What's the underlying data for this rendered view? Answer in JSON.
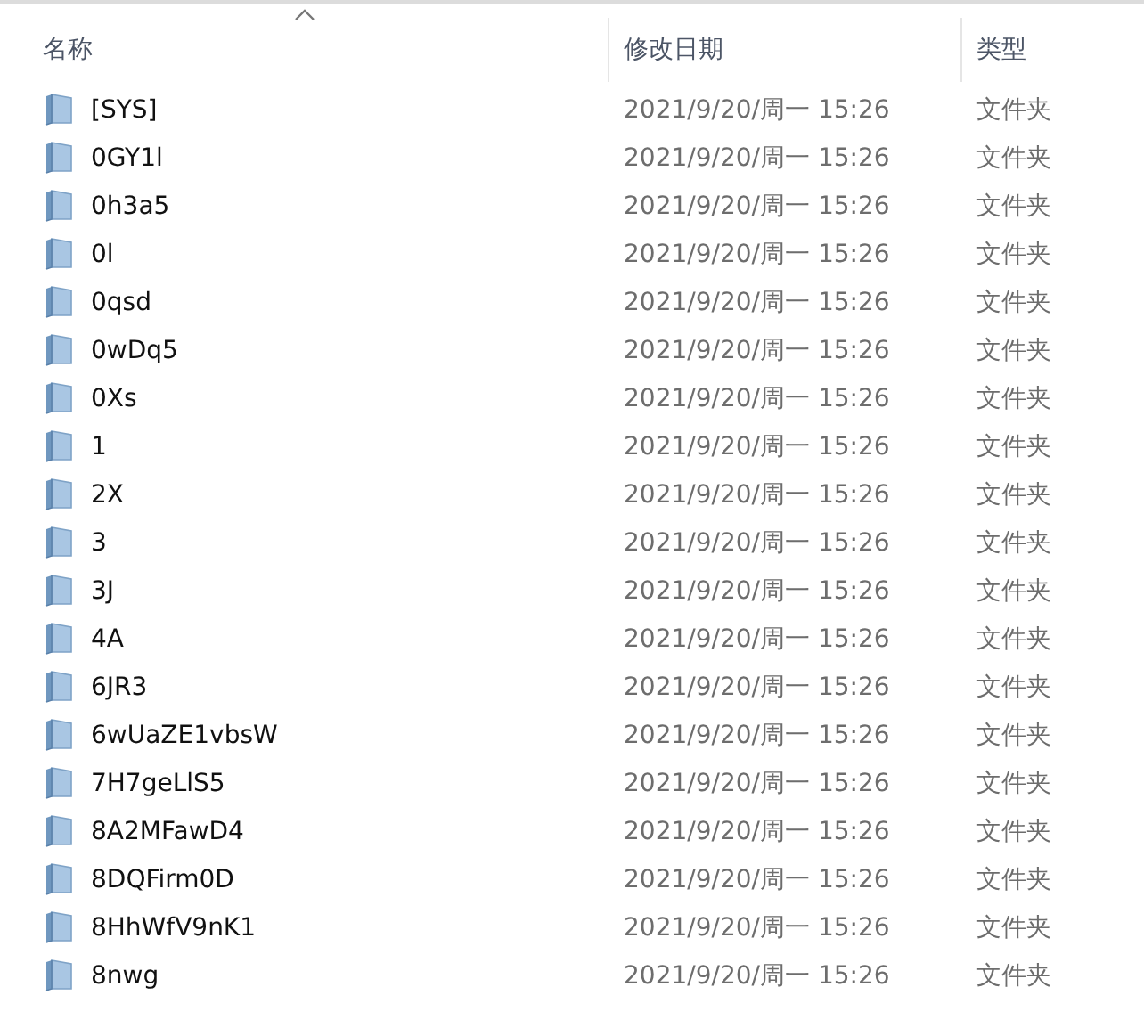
{
  "columns": [
    {
      "label": "名称",
      "sorted": true
    },
    {
      "label": "修改日期",
      "sorted": false
    },
    {
      "label": "类型",
      "sorted": false
    }
  ],
  "rows": [
    {
      "name": "[SYS]",
      "modified": "2021/9/20/周一 15:26",
      "type": "文件夹"
    },
    {
      "name": "0GY1l",
      "modified": "2021/9/20/周一 15:26",
      "type": "文件夹"
    },
    {
      "name": "0h3a5",
      "modified": "2021/9/20/周一 15:26",
      "type": "文件夹"
    },
    {
      "name": "0l",
      "modified": "2021/9/20/周一 15:26",
      "type": "文件夹"
    },
    {
      "name": "0qsd",
      "modified": "2021/9/20/周一 15:26",
      "type": "文件夹"
    },
    {
      "name": "0wDq5",
      "modified": "2021/9/20/周一 15:26",
      "type": "文件夹"
    },
    {
      "name": "0Xs",
      "modified": "2021/9/20/周一 15:26",
      "type": "文件夹"
    },
    {
      "name": "1",
      "modified": "2021/9/20/周一 15:26",
      "type": "文件夹"
    },
    {
      "name": "2X",
      "modified": "2021/9/20/周一 15:26",
      "type": "文件夹"
    },
    {
      "name": "3",
      "modified": "2021/9/20/周一 15:26",
      "type": "文件夹"
    },
    {
      "name": "3J",
      "modified": "2021/9/20/周一 15:26",
      "type": "文件夹"
    },
    {
      "name": "4A",
      "modified": "2021/9/20/周一 15:26",
      "type": "文件夹"
    },
    {
      "name": "6JR3",
      "modified": "2021/9/20/周一 15:26",
      "type": "文件夹"
    },
    {
      "name": "6wUaZE1vbsW",
      "modified": "2021/9/20/周一 15:26",
      "type": "文件夹"
    },
    {
      "name": "7H7geLlS5",
      "modified": "2021/9/20/周一 15:26",
      "type": "文件夹"
    },
    {
      "name": "8A2MFawD4",
      "modified": "2021/9/20/周一 15:26",
      "type": "文件夹"
    },
    {
      "name": "8DQFirm0D",
      "modified": "2021/9/20/周一 15:26",
      "type": "文件夹"
    },
    {
      "name": "8HhWfV9nK1",
      "modified": "2021/9/20/周一 15:26",
      "type": "文件夹"
    },
    {
      "name": "8nwg",
      "modified": "2021/9/20/周一 15:26",
      "type": "文件夹"
    }
  ]
}
